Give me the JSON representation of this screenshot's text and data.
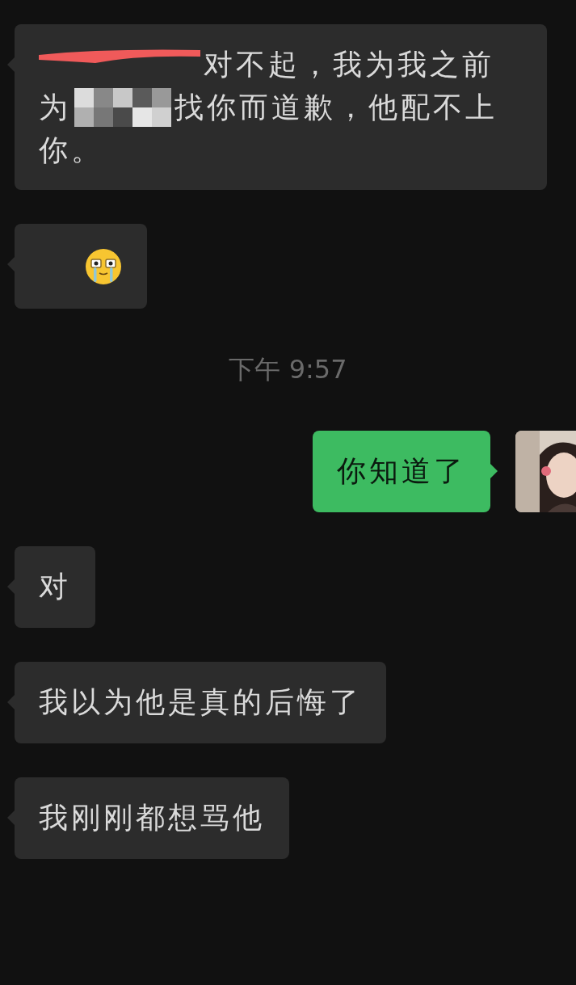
{
  "messages": [
    {
      "kind": "received",
      "lines": [
        [
          {
            "kind": "scribble"
          },
          {
            "kind": "text",
            "text": "对不起，我为我之前"
          }
        ],
        [
          {
            "kind": "text",
            "text": "为"
          },
          {
            "kind": "mosaic"
          },
          {
            "kind": "text",
            "text": "找你而道歉，他配不上"
          }
        ],
        [
          {
            "kind": "text",
            "text": "你。"
          }
        ]
      ]
    },
    {
      "kind": "received",
      "lines": [
        [
          {
            "kind": "emoji"
          }
        ]
      ]
    },
    {
      "kind": "time",
      "text": "下午 9:57"
    },
    {
      "kind": "sent",
      "lines": [
        [
          {
            "kind": "text",
            "text": "你知道了"
          }
        ]
      ]
    },
    {
      "kind": "received",
      "lines": [
        [
          {
            "kind": "text",
            "text": "对"
          }
        ]
      ]
    },
    {
      "kind": "received",
      "lines": [
        [
          {
            "kind": "text",
            "text": "我以为他是真的后悔了"
          }
        ]
      ]
    },
    {
      "kind": "received",
      "lines": [
        [
          {
            "kind": "text",
            "text": "我刚刚都想骂他"
          }
        ]
      ]
    }
  ]
}
